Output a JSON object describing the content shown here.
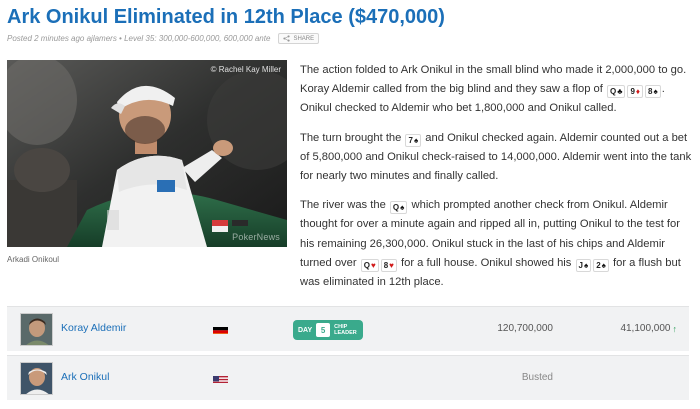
{
  "post": {
    "title": "Ark Onikul Eliminated in 12th Place ($470,000)",
    "meta": "Posted 2 minutes ago ajlamers • Level 35: 300,000-600,000, 600,000 ante",
    "share_label": "SHARE"
  },
  "photo": {
    "credit": "© Rachel Kay Miller",
    "watermark": "PokerNews",
    "caption": "Arkadi Onikoul"
  },
  "paragraphs": {
    "p1": {
      "a": "The action folded to Ark Onikul in the small blind who made it 2,000,000 to go. Koray Aldemir called from the big blind and they saw a flop of ",
      "b": ". Onikul checked to Aldemir who bet 1,800,000 and Onikul called."
    },
    "p2": {
      "a": "The turn brought the ",
      "b": " and Onikul checked again. Aldemir counted out a bet of 5,800,000 and Onikul check-raised to 14,000,000. Aldemir went into the tank for nearly two minutes and finally called."
    },
    "p3": {
      "a": "The river was the ",
      "b": " which prompted another check from Onikul. Aldemir thought for over a minute again and ripped all in, putting Onikul to the test for his remaining 26,300,000. Onikul stuck in the last of his chips and Aldemir turned over ",
      "c": " for a full house. Onikul showed his ",
      "d": " for a flush but was eliminated in 12th place."
    }
  },
  "cards": {
    "flop": [
      {
        "rank": "Q",
        "suit": "♣",
        "color": "#111111"
      },
      {
        "rank": "9",
        "suit": "♦",
        "color": "#d11a1a"
      },
      {
        "rank": "8",
        "suit": "♠",
        "color": "#111111"
      }
    ],
    "turn": [
      {
        "rank": "7",
        "suit": "♠",
        "color": "#111111"
      }
    ],
    "river": [
      {
        "rank": "Q",
        "suit": "♠",
        "color": "#111111"
      }
    ],
    "aldemir": [
      {
        "rank": "Q",
        "suit": "♥",
        "color": "#d11a1a"
      },
      {
        "rank": "8",
        "suit": "♥",
        "color": "#d11a1a"
      }
    ],
    "onikul": [
      {
        "rank": "J",
        "suit": "♠",
        "color": "#111111"
      },
      {
        "rank": "2",
        "suit": "♠",
        "color": "#111111"
      }
    ]
  },
  "players": [
    {
      "name": "Koray Aldemir",
      "country": "Germany",
      "badge": {
        "day": "DAY",
        "number": "5",
        "label_line1": "CHIP",
        "label_line2": "LEADER"
      },
      "chips": "120,700,000",
      "change": "41,100,000",
      "trend": "up-arrow-icon"
    },
    {
      "name": "Ark Onikul",
      "country": "United States",
      "status": "Busted"
    }
  ],
  "colors": {
    "title": "#1b6fb8",
    "badge": "#3aaa8c",
    "trend_up": "#2e9e5a",
    "red_suit": "#d11a1a"
  }
}
